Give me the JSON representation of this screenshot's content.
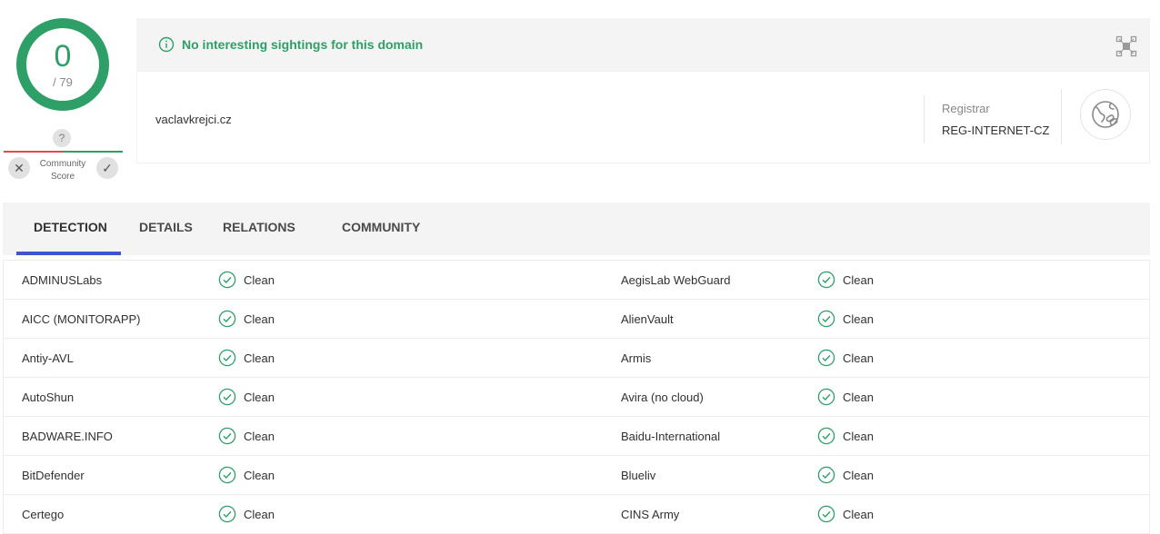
{
  "score": {
    "value": "0",
    "total": "/ 79"
  },
  "community_score": {
    "question": "?",
    "label_line1": "Community",
    "label_line2": "Score",
    "down_symbol": "✕",
    "up_symbol": "✓"
  },
  "banner": {
    "text": "No interesting sightings for this domain",
    "color": "#2e9f67"
  },
  "domain": {
    "name": "vaclavkrejci.cz",
    "registrar_label": "Registrar",
    "registrar_value": "REG-INTERNET-CZ"
  },
  "tabs": [
    {
      "label": "DETECTION"
    },
    {
      "label": "DETAILS"
    },
    {
      "label": "RELATIONS"
    },
    {
      "label": "COMMUNITY"
    }
  ],
  "detections": [
    {
      "left_engine": "ADMINUSLabs",
      "left_verdict": "Clean",
      "right_engine": "AegisLab WebGuard",
      "right_verdict": "Clean"
    },
    {
      "left_engine": "AICC (MONITORAPP)",
      "left_verdict": "Clean",
      "right_engine": "AlienVault",
      "right_verdict": "Clean"
    },
    {
      "left_engine": "Antiy-AVL",
      "left_verdict": "Clean",
      "right_engine": "Armis",
      "right_verdict": "Clean"
    },
    {
      "left_engine": "AutoShun",
      "left_verdict": "Clean",
      "right_engine": "Avira (no cloud)",
      "right_verdict": "Clean"
    },
    {
      "left_engine": "BADWARE.INFO",
      "left_verdict": "Clean",
      "right_engine": "Baidu-International",
      "right_verdict": "Clean"
    },
    {
      "left_engine": "BitDefender",
      "left_verdict": "Clean",
      "right_engine": "Blueliv",
      "right_verdict": "Clean"
    },
    {
      "left_engine": "Certego",
      "left_verdict": "Clean",
      "right_engine": "CINS Army",
      "right_verdict": "Clean"
    }
  ],
  "colors": {
    "accent_green": "#2e9f67",
    "accent_red": "#e5474e",
    "tab_underline": "#3d55d1"
  }
}
